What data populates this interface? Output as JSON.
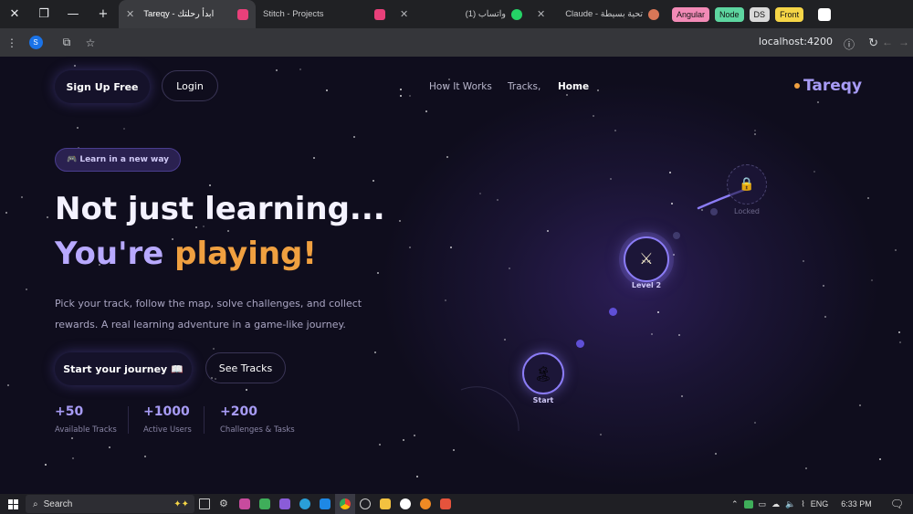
{
  "browser": {
    "tabs": [
      {
        "title": "Tareqy - ابدأ رحلتك",
        "active": true,
        "favicon_color": "#e8407a"
      },
      {
        "title": "Stitch - Projects",
        "active": false,
        "favicon_color": "#e8407a"
      },
      {
        "title": "(1) واتساب",
        "active": false,
        "favicon_color": "#25d366"
      },
      {
        "title": "Claude - تحية بسيطة",
        "active": false,
        "favicon_color": "#d97757"
      }
    ],
    "tab_groups": [
      {
        "label": "Angular",
        "color": "#f28ab6"
      },
      {
        "label": "Node",
        "color": "#5dd6a0"
      },
      {
        "label": "DS",
        "color": "#d9d9d9"
      },
      {
        "label": "Front",
        "color": "#f5d547"
      }
    ],
    "url": "localhost:4200",
    "profile_initial": "S"
  },
  "header": {
    "logo": "Tareqy",
    "nav": [
      "How It Works",
      "Tracks,",
      "Home"
    ],
    "signup_label": "Sign Up Free",
    "login_label": "Login"
  },
  "hero": {
    "badge": "🎮 Learn in a new way",
    "title_line1": "Not just learning...",
    "title_line2_a": "You're ",
    "title_line2_b": "playing!",
    "description_line1": "Pick your track, follow the map, solve challenges, and collect",
    "description_line2": "rewards. A real learning adventure in a game-like journey.",
    "primary_cta": "Start your journey 📖",
    "secondary_cta": "See Tracks"
  },
  "stats": [
    {
      "value": "+50",
      "label": "Available Tracks"
    },
    {
      "value": "+1000",
      "label": "Active Users"
    },
    {
      "value": "+200",
      "label": "Challenges & Tasks"
    }
  ],
  "map": {
    "nodes": [
      {
        "label": "Start",
        "icon": "🏝"
      },
      {
        "label": "Level 2",
        "icon": "⚔"
      },
      {
        "label": "Locked",
        "icon": "🔒"
      }
    ]
  },
  "taskbar": {
    "search_label": "Search",
    "language": "ENG",
    "time": "6:33 PM"
  },
  "colors": {
    "accent": "#7c6cf0",
    "title_gradient_start": "#b8a9ff",
    "title_gradient_end": "#f0a040"
  }
}
